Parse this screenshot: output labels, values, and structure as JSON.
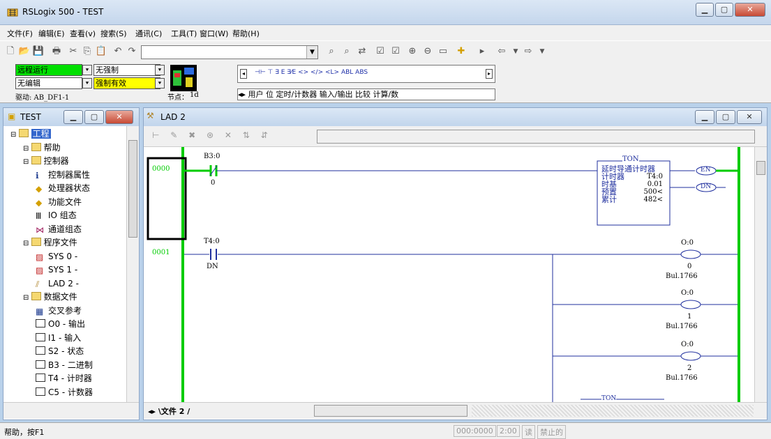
{
  "window": {
    "title": "RSLogix 500 - TEST"
  },
  "menu": [
    "文件(F)",
    "编辑(E)",
    "查看(v)",
    "搜索(S)",
    "通讯(C)",
    "工具(T)",
    "窗口(W)",
    "帮助(H)"
  ],
  "status": {
    "mode": "远程运行",
    "force": "无强制",
    "edit": "无编辑",
    "force_enabled": "强制有效",
    "driver": "驱动: AB_DF1-1",
    "node_label": "节点：",
    "node": "1d"
  },
  "instr_tabs": "用户 位 定时/计数器 输入/输出 比较 计算/数",
  "instr_symbols": "ABL  ABS",
  "project": {
    "title": "TEST",
    "tree": [
      {
        "label": "工程",
        "level": 0,
        "icon": "folder-icon"
      },
      {
        "label": "帮助",
        "level": 1,
        "icon": "folder-icon"
      },
      {
        "label": "控制器",
        "level": 1,
        "icon": "folder-icon"
      },
      {
        "label": "控制器属性",
        "level": 2,
        "icon": "info-icon"
      },
      {
        "label": "处理器状态",
        "level": 2,
        "icon": "diamond-icon"
      },
      {
        "label": "功能文件",
        "level": 2,
        "icon": "diamond-icon"
      },
      {
        "label": "IO 组态",
        "level": 2,
        "icon": "io-icon"
      },
      {
        "label": "通道组态",
        "level": 2,
        "icon": "channel-icon"
      },
      {
        "label": "程序文件",
        "level": 1,
        "icon": "folder-icon"
      },
      {
        "label": "SYS 0 -",
        "level": 2,
        "icon": "sys-icon"
      },
      {
        "label": "SYS 1 -",
        "level": 2,
        "icon": "sys-icon"
      },
      {
        "label": "LAD 2 -",
        "level": 2,
        "icon": "ladder-icon"
      },
      {
        "label": "数据文件",
        "level": 1,
        "icon": "folder-icon"
      },
      {
        "label": "交叉参考",
        "level": 2,
        "icon": "xref-icon"
      },
      {
        "label": "O0 - 输出",
        "level": 2,
        "icon": "file-icon"
      },
      {
        "label": "I1 - 输入",
        "level": 2,
        "icon": "file-icon"
      },
      {
        "label": "S2 - 状态",
        "level": 2,
        "icon": "file-icon"
      },
      {
        "label": "B3 - 二进制",
        "level": 2,
        "icon": "file-icon"
      },
      {
        "label": "T4 - 计时器",
        "level": 2,
        "icon": "file-icon"
      },
      {
        "label": "C5 - 计数器",
        "level": 2,
        "icon": "file-icon"
      }
    ]
  },
  "ladder": {
    "title": "LAD 2",
    "file_tab": "文件 2",
    "rung0": {
      "num": "0000",
      "contact_addr": "B3:0",
      "contact_bit": "0",
      "ton": {
        "head": "TON",
        "title": "延时导通计时器",
        "timer_label": "计时器",
        "timer": "T4:0",
        "timebase_label": "时基",
        "timebase": "0.01",
        "preset_label": "预置",
        "preset": "500<",
        "accum_label": "累计",
        "accum": "482<",
        "en": "EN",
        "dn": "DN"
      }
    },
    "rung1": {
      "num": "0001",
      "contact_addr": "T4:0",
      "contact_bit": "DN",
      "outputs": [
        {
          "addr": "O:0",
          "bit": "0",
          "module": "Bul.1766"
        },
        {
          "addr": "O:0",
          "bit": "1",
          "module": "Bul.1766"
        },
        {
          "addr": "O:0",
          "bit": "2",
          "module": "Bul.1766"
        }
      ],
      "ton_head": "TON"
    }
  },
  "statusbar": {
    "help": "帮助，按F1",
    "pos": "000:0000",
    "time": "2:00",
    "mode": "读",
    "state": "禁止的"
  }
}
